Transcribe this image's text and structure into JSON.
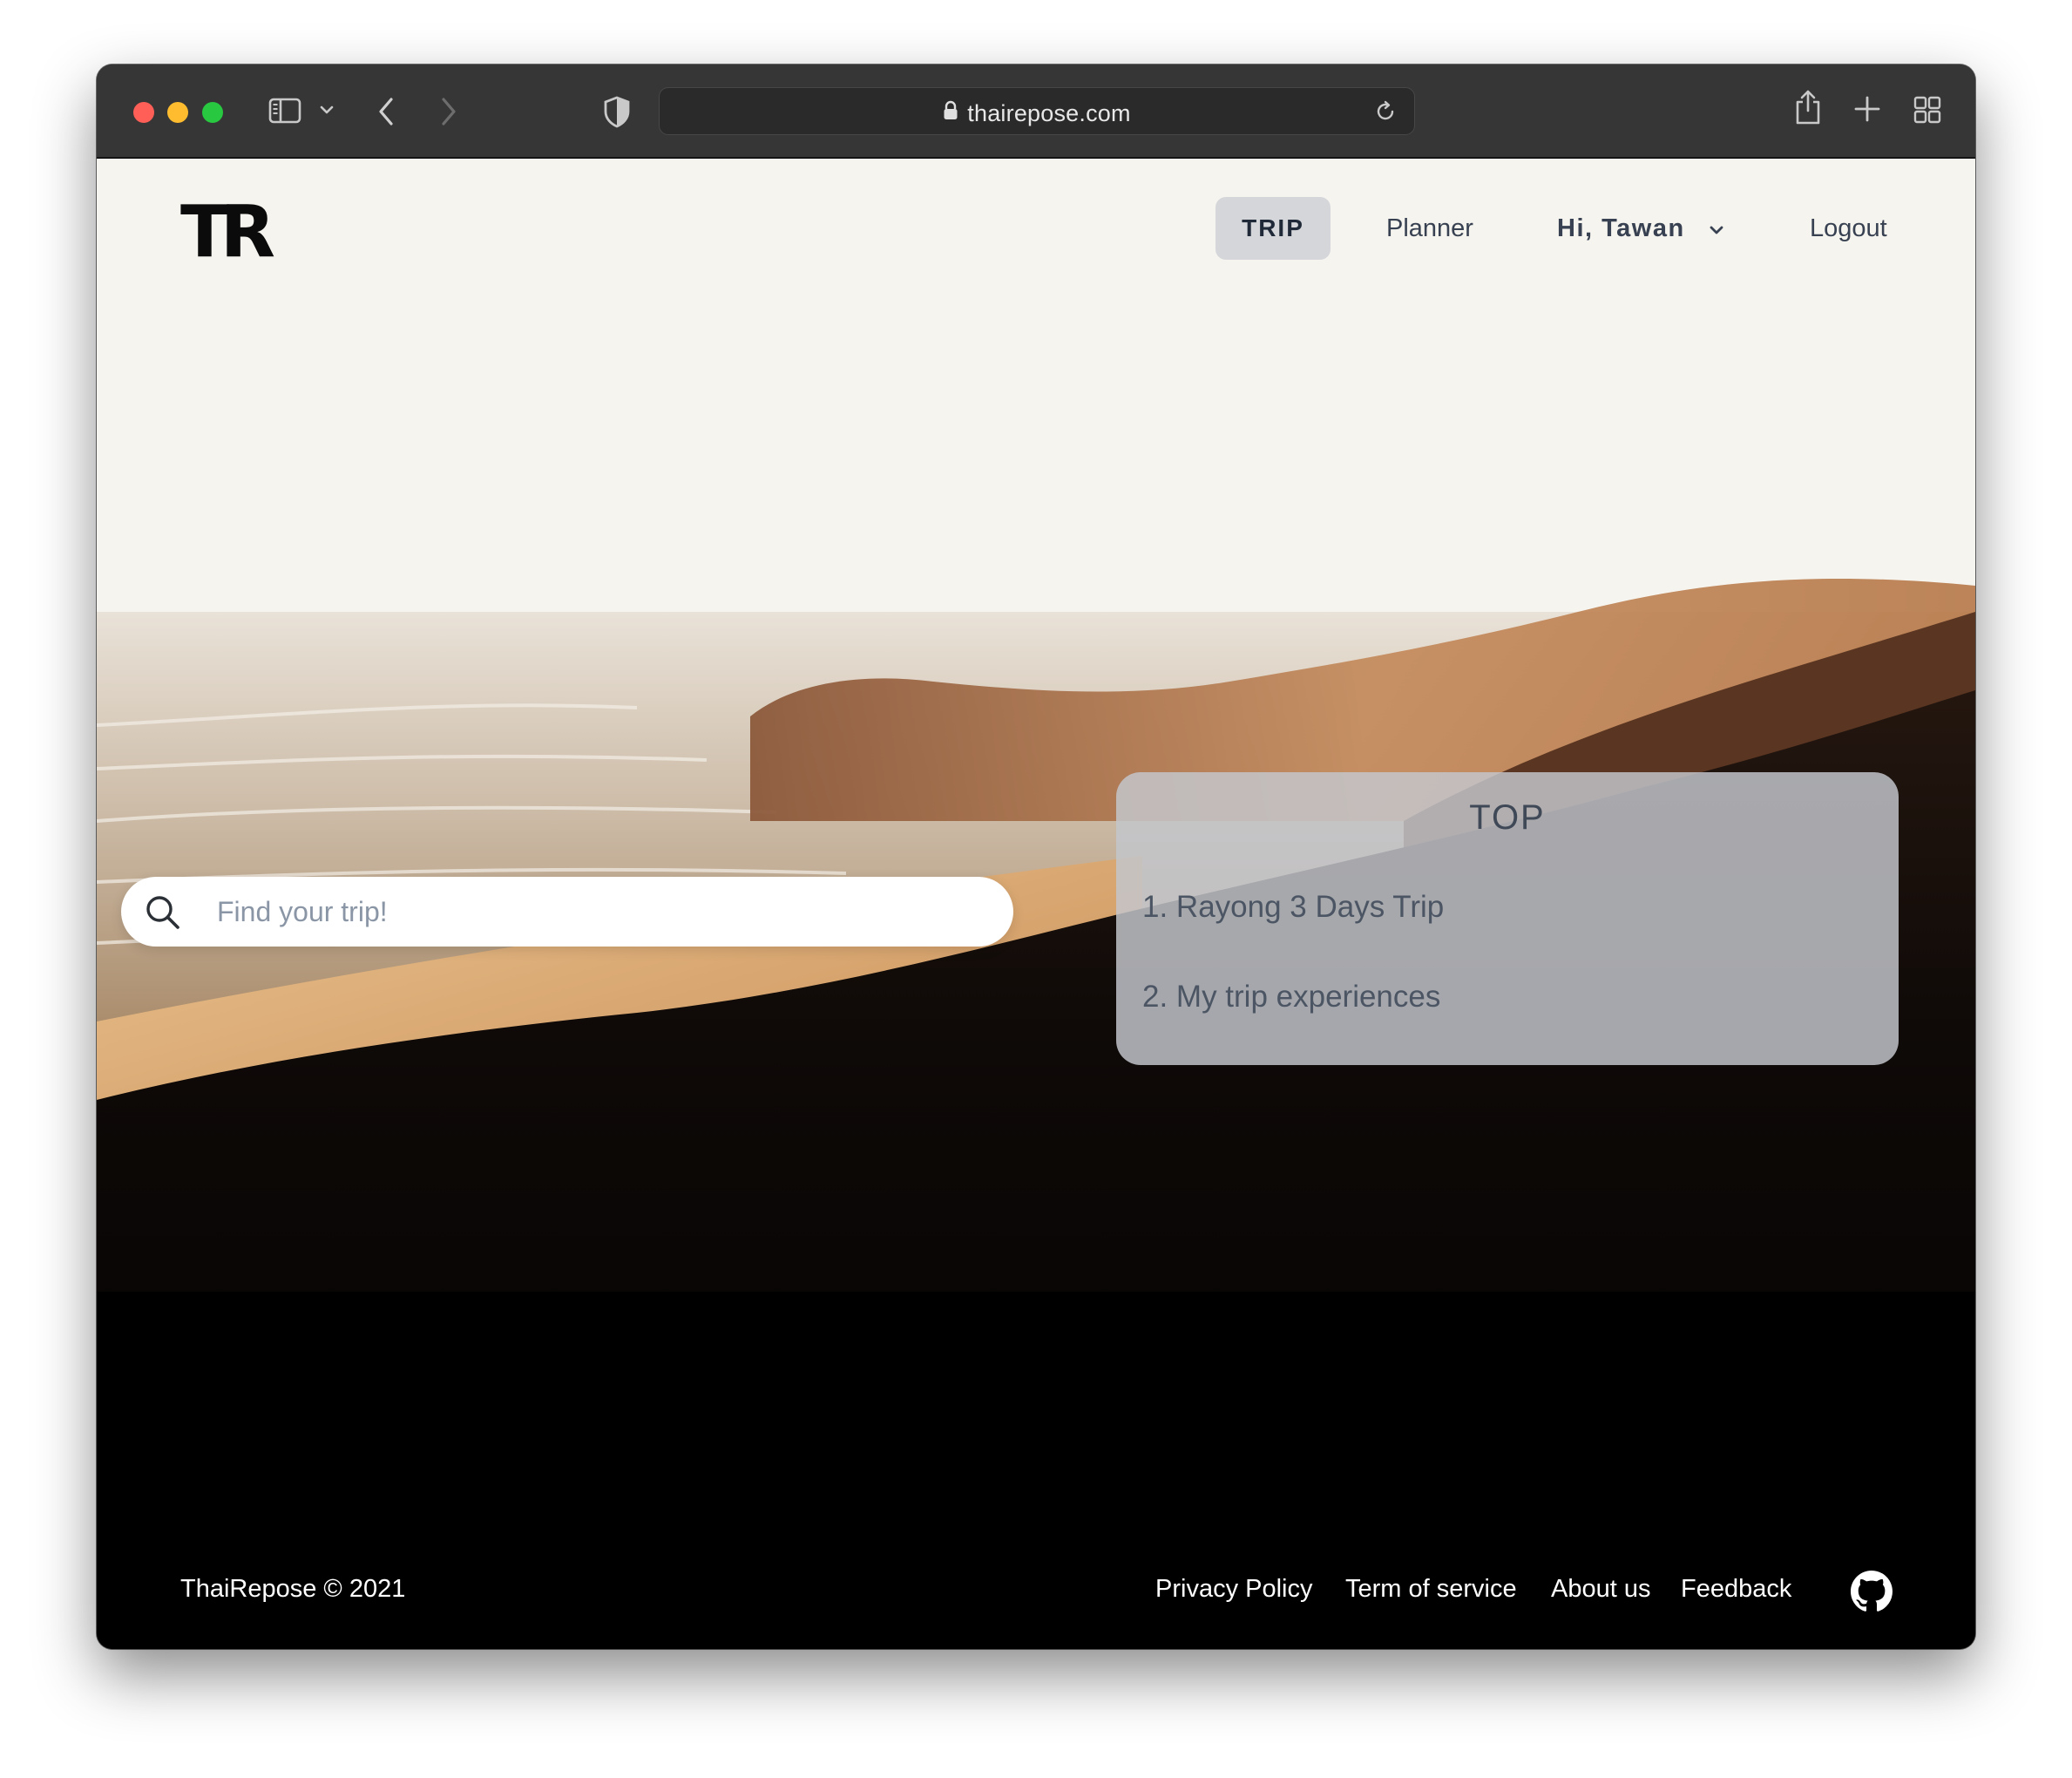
{
  "browser": {
    "url": "thairepose.com",
    "icons": [
      "sidebar-icon",
      "chevron-down-icon",
      "back-icon",
      "forward-icon",
      "shield-icon",
      "lock-icon",
      "reload-icon",
      "share-icon",
      "new-tab-icon",
      "tab-overview-icon"
    ]
  },
  "nav": {
    "logo": "TR",
    "trip": "TRIP",
    "planner": "Planner",
    "user": "Hi, Tawan",
    "logout": "Logout"
  },
  "search": {
    "placeholder": "Find your trip!"
  },
  "top": {
    "title": "TOP",
    "items": [
      "1. Rayong 3 Days Trip",
      "2. My trip experiences"
    ]
  },
  "footer": {
    "copyright": "ThaiRepose © 2021",
    "links": [
      "Privacy Policy",
      "Term of service",
      "About us",
      "Feedback"
    ],
    "github_icon": "github-icon"
  },
  "colors": {
    "toolbar": "#363636",
    "active_nav": "#d4d6da",
    "panel": "#c4c6cc"
  }
}
